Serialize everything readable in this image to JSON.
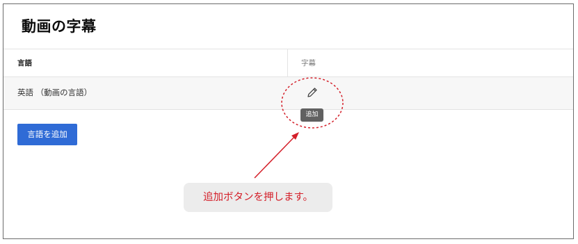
{
  "page": {
    "title": "動画の字幕"
  },
  "table": {
    "headers": {
      "language": "言語",
      "subtitles": "字幕"
    },
    "rows": [
      {
        "language": "英語 （動画の言語）"
      }
    ]
  },
  "tooltip": {
    "text": "追加"
  },
  "buttons": {
    "add_language": "言語を追加"
  },
  "annotation": {
    "callout_text": "追加ボタンを押します。",
    "color": "#d4202a"
  },
  "icons": {
    "edit": "pencil-icon"
  },
  "colors": {
    "primary_button": "#2f6bd6",
    "tooltip_bg": "#616161",
    "row_bg": "#f7f7f7"
  }
}
